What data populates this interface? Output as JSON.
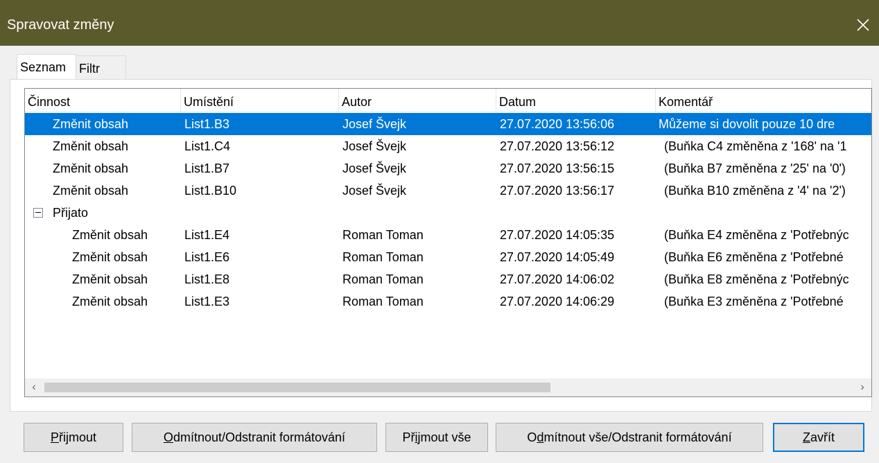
{
  "window": {
    "title": "Spravovat změny"
  },
  "tabs": [
    {
      "label": "Seznam",
      "active": true
    },
    {
      "label": "Filtr",
      "active": false
    }
  ],
  "table": {
    "columns": [
      "Činnost",
      "Umístění",
      "Autor",
      "Datum",
      "Komentář"
    ],
    "rows": [
      {
        "action": "Změnit obsah",
        "location": "List1.B3",
        "author": "Josef Švejk",
        "date": "27.07.2020 13:56:06",
        "comment": "Můžeme si dovolit pouze 10 dre",
        "selected": true
      },
      {
        "action": "Změnit obsah",
        "location": "List1.C4",
        "author": "Josef Švejk",
        "date": "27.07.2020 13:56:12",
        "comment": "(Buňka C4 změněna z '168' na '1"
      },
      {
        "action": "Změnit obsah",
        "location": "List1.B7",
        "author": "Josef Švejk",
        "date": "27.07.2020 13:56:15",
        "comment": "(Buňka B7 změněna z '25' na '0')"
      },
      {
        "action": "Změnit obsah",
        "location": "List1.B10",
        "author": "Josef Švejk",
        "date": "27.07.2020 13:56:17",
        "comment": "(Buňka B10 změněna z '4' na '2')"
      },
      {
        "group": "Přijato",
        "expanded": true
      },
      {
        "action": "Změnit obsah",
        "location": "List1.E4",
        "author": "Roman Toman",
        "date": "27.07.2020 14:05:35",
        "comment": "(Buňka E4 změněna z 'Potřebnýc"
      },
      {
        "action": "Změnit obsah",
        "location": "List1.E6",
        "author": "Roman Toman",
        "date": "27.07.2020 14:05:49",
        "comment": "(Buňka E6 změněna z 'Potřebné"
      },
      {
        "action": "Změnit obsah",
        "location": "List1.E8",
        "author": "Roman Toman",
        "date": "27.07.2020 14:06:02",
        "comment": "(Buňka E8 změněna z 'Potřebnýc"
      },
      {
        "action": "Změnit obsah",
        "location": "List1.E3",
        "author": "Roman Toman",
        "date": "27.07.2020 14:06:29",
        "comment": "(Buňka E3 změněna z 'Potřebné"
      }
    ]
  },
  "buttons": {
    "accept": {
      "pre": "",
      "key": "P",
      "post": "řijmout"
    },
    "reject": {
      "pre": "",
      "key": "O",
      "post": "dmítnout/Odstranit formátování"
    },
    "accept_all": {
      "pre": "Př",
      "key": "i",
      "post": "jmout vše"
    },
    "reject_all": {
      "pre": "O",
      "key": "d",
      "post": "mítnout vše/Odstranit formátování"
    },
    "close": {
      "pre": "",
      "key": "Z",
      "post": "avřít"
    }
  },
  "icons": {
    "close": "close-icon",
    "expander": "collapse-minus-icon",
    "scroll_left": "chevron-left-icon",
    "scroll_right": "chevron-right-icon"
  },
  "colors": {
    "titlebar": "#5a5a2c",
    "selection": "#0078d7"
  }
}
